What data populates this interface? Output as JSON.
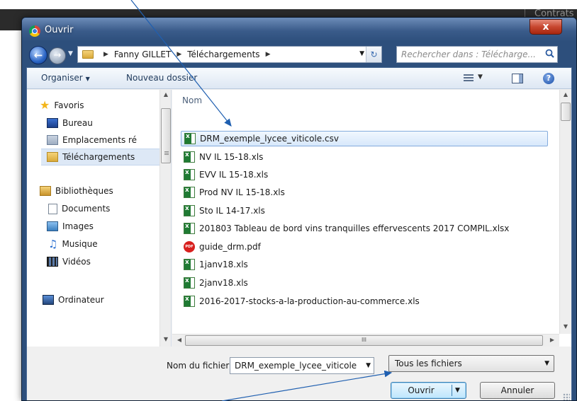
{
  "background": {
    "right_text": "Contrats"
  },
  "window": {
    "title": "Ouvrir",
    "close_label": "x"
  },
  "address_bar": {
    "crumbs": [
      "Fanny GILLET",
      "Téléchargements"
    ],
    "search_placeholder": "Rechercher dans : Télécharge..."
  },
  "toolbar": {
    "organize_label": "Organiser",
    "new_folder_label": "Nouveau dossier",
    "help_label": "?"
  },
  "nav_pane": {
    "favorites_label": "Favoris",
    "favorites": [
      "Bureau",
      "Emplacements ré",
      "Téléchargements"
    ],
    "libraries_label": "Bibliothèques",
    "libraries": [
      "Documents",
      "Images",
      "Musique",
      "Vidéos"
    ],
    "computer_label": "Ordinateur"
  },
  "file_list": {
    "column_name": "Nom",
    "files": [
      "DRM_exemple_lycee_viticole.csv",
      "NV IL 15-18.xls",
      "EVV IL 15-18.xls",
      "Prod NV IL 15-18.xls",
      "Sto IL 14-17.xls",
      "201803 Tableau de bord vins tranquilles effervescents 2017 COMPIL.xlsx",
      "guide_drm.pdf",
      "1janv18.xls",
      "2janv18.xls",
      "2016-2017-stocks-a-la-production-au-commerce.xls"
    ],
    "pdf_badge": "PDF",
    "hscroll_label": "III"
  },
  "bottom": {
    "filename_label": "Nom du fichier :",
    "filename_value": "DRM_exemple_lycee_viticole",
    "filetype_value": "Tous les fichiers",
    "open_label": "Ouvrir",
    "cancel_label": "Annuler"
  },
  "colors": {
    "window_frame": "#2d4f7c",
    "selection": "#d7e8fb",
    "annotation_arrow": "#1f5fb0"
  }
}
